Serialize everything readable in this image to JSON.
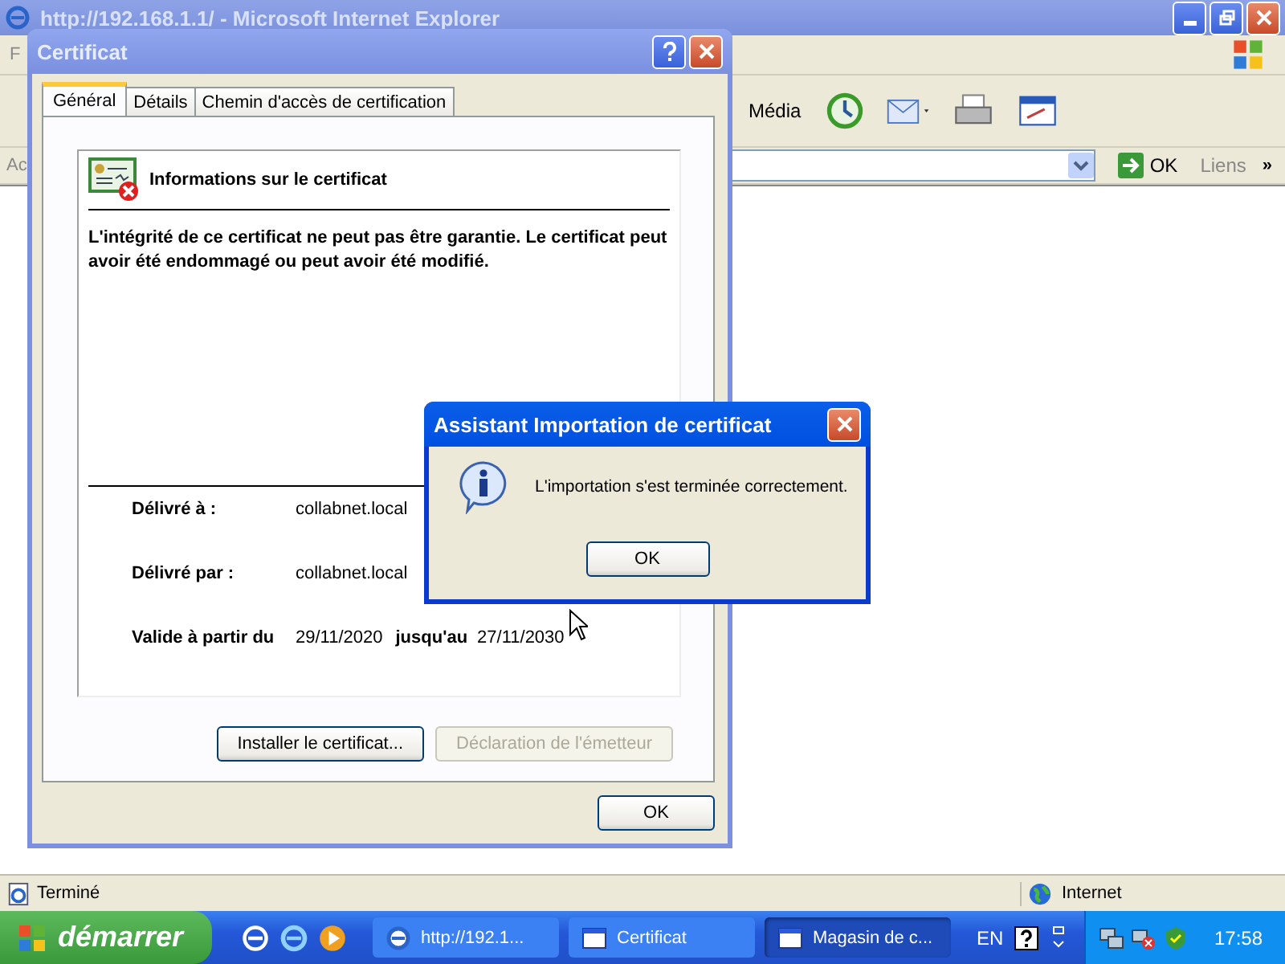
{
  "browser": {
    "title": "http://192.168.1.1/ - Microsoft Internet Explorer",
    "menu_fragment": "F",
    "toolbar": [
      {
        "label": "Média"
      }
    ],
    "address_label": "Ac",
    "go_button": "OK",
    "links_label": "Liens",
    "links_more": "»",
    "status": "Terminé",
    "zone": "Internet"
  },
  "certificate_dialog": {
    "title": "Certificat",
    "tabs": [
      {
        "label": "Général",
        "selected": true
      },
      {
        "label": "Détails",
        "selected": false
      },
      {
        "label": "Chemin d'accès de certification",
        "selected": false
      }
    ],
    "heading": "Informations sur le certificat",
    "warning": "L'intégrité de ce certificat ne peut pas être garantie. Le certificat peut avoir été endommagé ou peut avoir été modifié.",
    "issued_to_label": "Délivré à :",
    "issued_to": "collabnet.local",
    "issued_by_label": "Délivré par :",
    "issued_by": "collabnet.local",
    "valid_from_label": "Valide à partir du",
    "valid_from": "29/11/2020",
    "valid_to_label": "jusqu'au",
    "valid_to": "27/11/2030",
    "buttons": [
      {
        "label": "Installer le certificat...",
        "disabled": false
      },
      {
        "label": "Déclaration de l'émetteur",
        "disabled": true
      }
    ],
    "ok": "OK"
  },
  "import_dialog": {
    "title": "Assistant Importation de certificat",
    "message": "L'importation s'est terminée correctement.",
    "ok": "OK"
  },
  "taskbar": {
    "start": "démarrer",
    "tasks": [
      {
        "label": "http://192.1...",
        "kind": "browser",
        "selected": false
      },
      {
        "label": "Certificat",
        "kind": "window",
        "selected": false
      },
      {
        "label": "Magasin de c...",
        "kind": "window",
        "selected": true
      }
    ],
    "language": "EN",
    "clock": "17:58"
  }
}
